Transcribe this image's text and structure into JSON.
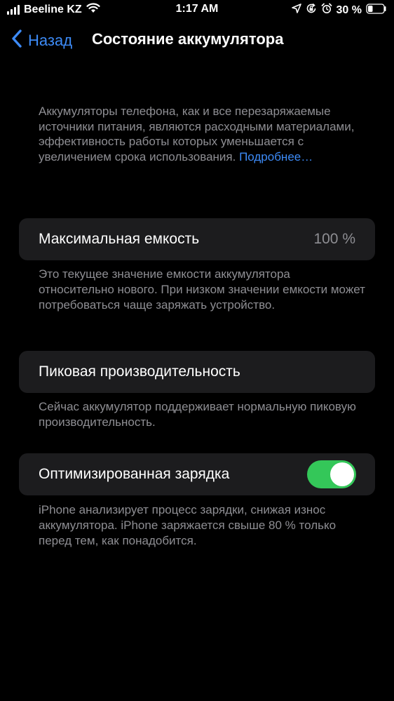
{
  "status_bar": {
    "carrier": "Beeline KZ",
    "time": "1:17 AM",
    "battery_percent": "30 %",
    "icons": [
      "signal-icon",
      "wifi-icon",
      "location-icon",
      "orientation-lock-icon",
      "alarm-icon",
      "battery-icon"
    ]
  },
  "nav": {
    "back_label": "Назад",
    "title": "Состояние аккумулятора"
  },
  "intro": {
    "text": "Аккумуляторы телефона, как и все перезаряжаемые источники питания, являются расходными материалами, эффективность работы которых уменьшается с увеличением срока использования. ",
    "learn_more": "Подробнее…"
  },
  "max_capacity": {
    "label": "Максимальная емкость",
    "value": "100 %",
    "footnote": "Это текущее значение емкости аккумулятора относительно нового. При низком значении емкости может потребоваться чаще заряжать устройство."
  },
  "peak_performance": {
    "label": "Пиковая производительность",
    "footnote": "Сейчас аккумулятор поддерживает нормальную пиковую производительность."
  },
  "optimized_charging": {
    "label": "Оптимизированная зарядка",
    "enabled": true,
    "footnote": "iPhone анализирует процесс зарядки, снижая износ аккумулятора. iPhone заряжается свыше 80 % только перед тем, как понадобится."
  },
  "colors": {
    "background": "#000000",
    "cell": "#1c1c1e",
    "accent": "#3d8bf7",
    "secondary_text": "#8e8e93",
    "toggle_on": "#34c759"
  }
}
